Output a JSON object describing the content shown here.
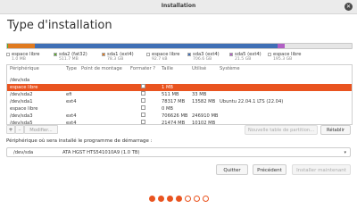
{
  "window": {
    "title": "Installation"
  },
  "page": {
    "heading": "Type d'installation"
  },
  "colors": {
    "accent": "#e95420",
    "free": "#ffffff",
    "fat32": "#59a92e",
    "ext4_a": "#e07a1f",
    "ext4_b": "#3f6fb5",
    "ext4_c": "#b15fc4"
  },
  "disk_usage": {
    "segments": [
      {
        "color": "#ffffff",
        "fraction": 0.0
      },
      {
        "color": "#59a92e",
        "fraction": 0.0005
      },
      {
        "color": "#e07a1f",
        "fraction": 0.078
      },
      {
        "color": "#ffffff",
        "fraction": 0.0
      },
      {
        "color": "#3f6fb5",
        "fraction": 0.705
      },
      {
        "color": "#b15fc4",
        "fraction": 0.021
      },
      {
        "color": "#e6e6e6",
        "fraction": 0.195
      }
    ]
  },
  "legend": [
    {
      "label": "espace libre",
      "size": "1.0 MB",
      "color": "#ffffff"
    },
    {
      "label": "sda2 (fat32)",
      "size": "511.7 MB",
      "color": "#59a92e"
    },
    {
      "label": "sda1 (ext4)",
      "size": "78.3 GB",
      "color": "#e07a1f"
    },
    {
      "label": "espace libre",
      "size": "92.7 kB",
      "color": "#ffffff"
    },
    {
      "label": "sda3 (ext4)",
      "size": "706.6 GB",
      "color": "#3f6fb5"
    },
    {
      "label": "sda5 (ext4)",
      "size": "21.5 GB",
      "color": "#b15fc4"
    },
    {
      "label": "espace libre",
      "size": "195.3 GB",
      "color": "#ffffff"
    }
  ],
  "table": {
    "headers": {
      "device": "Périphérique",
      "type": "Type",
      "mount": "Point de montage",
      "format": "Formater ?",
      "size": "Taille",
      "used": "Utilisé",
      "system": "Système"
    },
    "rows": [
      {
        "device": "/dev/sda",
        "type": "",
        "mount": "",
        "format": false,
        "size": "",
        "used": "",
        "system": "",
        "selected": false
      },
      {
        "device": "espace libre",
        "type": "",
        "mount": "",
        "format": false,
        "size": "1 MB",
        "used": "",
        "system": "",
        "selected": true
      },
      {
        "device": "/dev/sda2",
        "type": "efi",
        "mount": "",
        "format": false,
        "size": "511 MB",
        "used": "33 MB",
        "system": "",
        "selected": false
      },
      {
        "device": "/dev/sda1",
        "type": "ext4",
        "mount": "",
        "format": false,
        "size": "78317 MB",
        "used": "13582 MB",
        "system": "Ubuntu 22.04.1 LTS (22.04)",
        "selected": false
      },
      {
        "device": "espace libre",
        "type": "",
        "mount": "",
        "format": false,
        "size": "0 MB",
        "used": "",
        "system": "",
        "selected": false
      },
      {
        "device": "/dev/sda3",
        "type": "ext4",
        "mount": "",
        "format": false,
        "size": "706626 MB",
        "used": "246910 MB",
        "system": "",
        "selected": false
      },
      {
        "device": "/dev/sda5",
        "type": "ext4",
        "mount": "",
        "format": false,
        "size": "21474 MB",
        "used": "10102 MB",
        "system": "",
        "selected": false
      }
    ]
  },
  "table_buttons": {
    "add": "+",
    "remove": "–",
    "modify": "Modifier...",
    "new_table": "Nouvelle table de partition...",
    "revert": "Rétablir"
  },
  "boot": {
    "label": "Périphérique où sera installé le programme de démarrage :",
    "device": "/dev/sda",
    "model": "ATA HGST HTS541010A9 (1.0 TB)",
    "arrow": "▾"
  },
  "nav": {
    "quit": "Quitter",
    "back": "Précédent",
    "install": "Installer maintenant"
  },
  "progress": {
    "step": 4,
    "total": 7
  }
}
